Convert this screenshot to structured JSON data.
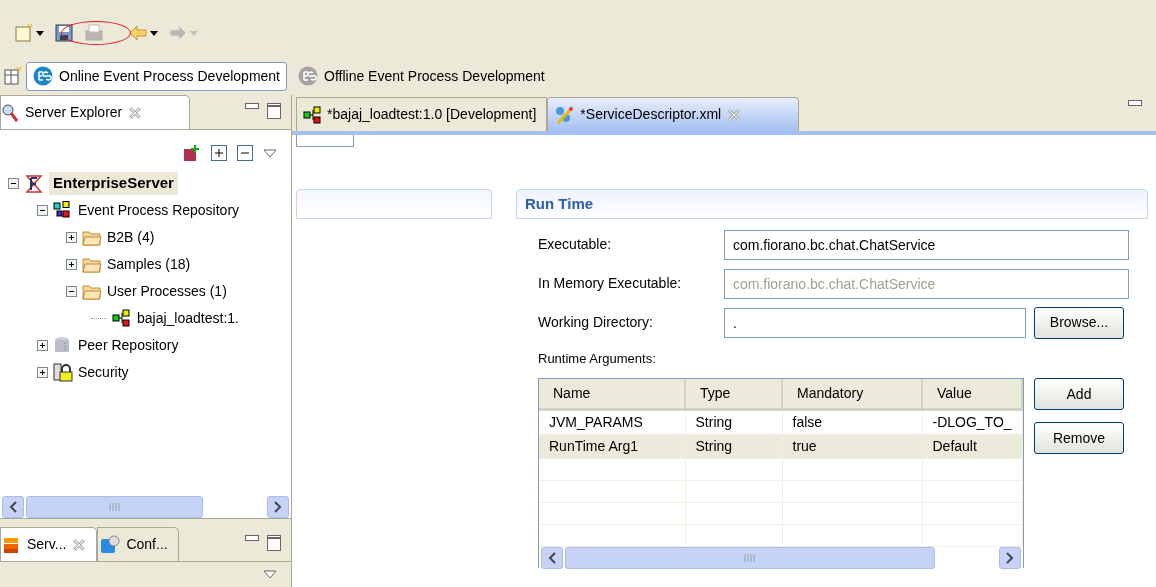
{
  "toolbar": {
    "buttons": [
      {
        "kind": "new",
        "disabled": false,
        "dropdown": true
      },
      {
        "kind": "save",
        "disabled": false,
        "dropdown": false
      },
      {
        "kind": "print",
        "disabled": true,
        "dropdown": false
      },
      {
        "kind": "back",
        "disabled": false,
        "dropdown": true
      },
      {
        "kind": "forward",
        "disabled": true,
        "dropdown": true
      }
    ]
  },
  "perspectives": [
    {
      "label": "Online Event Process Development",
      "selected": true
    },
    {
      "label": "Offline Event Process Development",
      "selected": false
    }
  ],
  "explorer": {
    "tab": {
      "label": "Server Explorer"
    },
    "tree": [
      {
        "kind": "server",
        "label": "EnterpriseServer",
        "selected": true,
        "expanded": true,
        "children": [
          {
            "kind": "repository",
            "label": "Event Process Repository",
            "selected": false,
            "expanded": true,
            "children": [
              {
                "kind": "folder",
                "label": "B2B (4)",
                "selected": false,
                "expanded": false
              },
              {
                "kind": "folder",
                "label": "Samples (18)",
                "selected": false,
                "expanded": false
              },
              {
                "kind": "folder",
                "label": "User Processes (1)",
                "selected": false,
                "expanded": true,
                "children": [
                  {
                    "kind": "process",
                    "label": "bajaj_loadtest:1.",
                    "selected": false
                  }
                ]
              }
            ]
          },
          {
            "kind": "peer",
            "label": "Peer Repository",
            "selected": false,
            "expanded": false
          },
          {
            "kind": "security",
            "label": "Security",
            "selected": false,
            "expanded": false
          }
        ]
      }
    ]
  },
  "bottom_views": [
    {
      "kind": "servers",
      "label": "Serv...",
      "selected": true
    },
    {
      "kind": "config",
      "label": "Conf...",
      "selected": false
    }
  ],
  "editor_tabs": [
    {
      "kind": "process",
      "label": "*bajaj_loadtest:1.0 [Development]",
      "selected": false
    },
    {
      "kind": "descriptor",
      "label": "*ServiceDescriptor.xml",
      "selected": true
    }
  ],
  "run_time": {
    "title": "Run Time",
    "fields": [
      {
        "label": "Executable:",
        "value": "com.fiorano.bc.chat.ChatService",
        "disabled": false
      },
      {
        "label": "In Memory Executable:",
        "value": "com.fiorano.bc.chat.ChatService",
        "disabled": true
      },
      {
        "label": "Working Directory:",
        "value": ".",
        "disabled": false,
        "button": "Browse..."
      }
    ],
    "arguments_label": "Runtime Arguments:",
    "table": {
      "columns": [
        "Name",
        "Type",
        "Mandatory",
        "Value"
      ],
      "rows": [
        {
          "cells": [
            "JVM_PARAMS",
            "String",
            "false",
            "-DLOG_TO_"
          ],
          "selected": false
        },
        {
          "cells": [
            "RunTime Arg1",
            "String",
            "true",
            "Default"
          ],
          "selected": true
        }
      ]
    },
    "buttons": [
      "Add",
      "Remove"
    ]
  }
}
